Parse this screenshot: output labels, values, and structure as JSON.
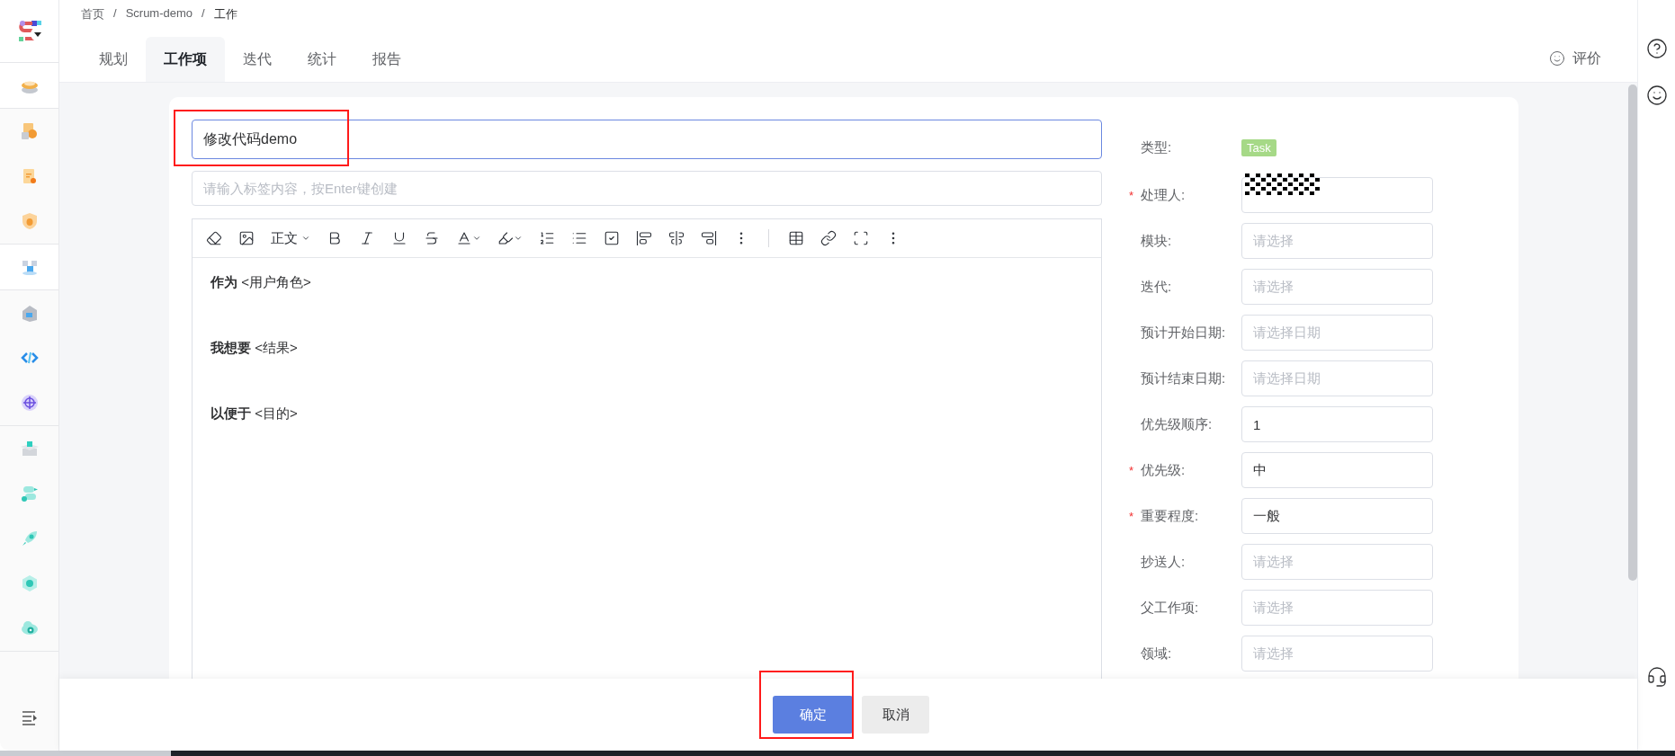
{
  "breadcrumb": {
    "separator": "/",
    "items": [
      "首页",
      "Scrum-demo",
      "工作"
    ]
  },
  "tabs": [
    {
      "label": "规划",
      "selected": false
    },
    {
      "label": "工作项",
      "selected": true
    },
    {
      "label": "迭代",
      "selected": false
    },
    {
      "label": "统计",
      "selected": false
    },
    {
      "label": "报告",
      "selected": false
    }
  ],
  "feedback": {
    "label": "评价"
  },
  "title_field": {
    "value": "修改代码demo",
    "highlighted": true
  },
  "tag_field": {
    "placeholder": "请输入标签内容，按Enter键创建"
  },
  "editor": {
    "style_select": "正文",
    "lines": [
      "**作为** <用户角色>",
      "**我想要** <结果>",
      "**以便于** <目的>"
    ]
  },
  "form": {
    "required_mark": "*",
    "fields": [
      {
        "label": "类型:",
        "required": false,
        "kind": "tag",
        "value": "Task",
        "color": "#a6d987"
      },
      {
        "label": "处理人:",
        "required": true,
        "kind": "mask"
      },
      {
        "label": "模块:",
        "required": false,
        "kind": "select",
        "placeholder": "请选择"
      },
      {
        "label": "迭代:",
        "required": false,
        "kind": "select",
        "placeholder": "请选择"
      },
      {
        "label": "预计开始日期:",
        "required": false,
        "kind": "select",
        "placeholder": "请选择日期"
      },
      {
        "label": "预计结束日期:",
        "required": false,
        "kind": "select",
        "placeholder": "请选择日期"
      },
      {
        "label": "优先级顺序:",
        "required": false,
        "kind": "select",
        "value": "1"
      },
      {
        "label": "优先级:",
        "required": true,
        "kind": "select",
        "value": "中"
      },
      {
        "label": "重要程度:",
        "required": true,
        "kind": "select",
        "value": "一般"
      },
      {
        "label": "抄送人:",
        "required": false,
        "kind": "select",
        "placeholder": "请选择"
      },
      {
        "label": "父工作项:",
        "required": false,
        "kind": "select",
        "placeholder": "请选择"
      },
      {
        "label": "领域:",
        "required": false,
        "kind": "select",
        "placeholder": "请选择"
      }
    ]
  },
  "footer": {
    "buttons": [
      {
        "label": "确定",
        "kind": "primary",
        "highlighted": true
      },
      {
        "label": "取消",
        "kind": "secondary",
        "highlighted": false
      }
    ]
  }
}
